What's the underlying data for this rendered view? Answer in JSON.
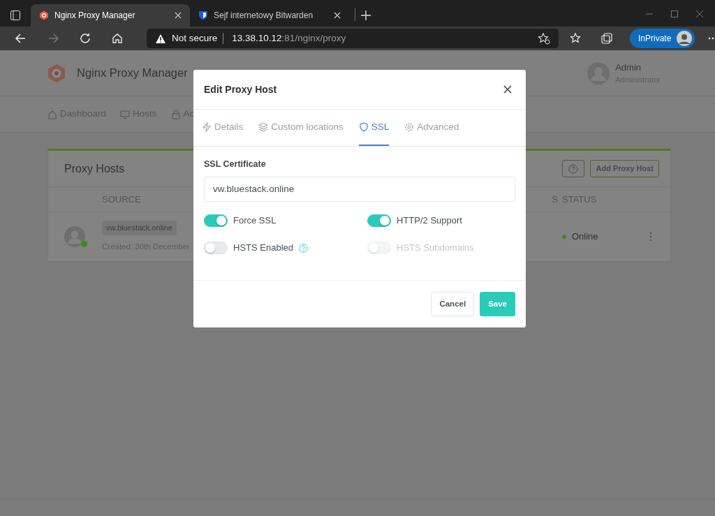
{
  "browser": {
    "tabs": [
      {
        "title": "Nginx Proxy Manager",
        "selected": true
      },
      {
        "title": "Sejf internetowy Bitwarden",
        "selected": false
      }
    ],
    "address": {
      "security": "Not secure",
      "host": "13.38.10.12",
      "path": ":81/nginx/proxy"
    },
    "profile": "InPrivate"
  },
  "app": {
    "brand": "Nginx Proxy Manager",
    "user": {
      "name": "Admin",
      "role": "Administrator"
    },
    "nav": [
      {
        "label": "Dashboard"
      },
      {
        "label": "Hosts"
      },
      {
        "label": "Ac"
      }
    ],
    "card": {
      "title": "Proxy Hosts",
      "add_button": "Add Proxy Host",
      "columns": [
        "SOURCE",
        "S",
        "STATUS"
      ],
      "rows": [
        {
          "source": "vw.bluestack.online",
          "created": "Created: 30th December",
          "status": "Online",
          "online": true
        }
      ]
    }
  },
  "modal": {
    "title": "Edit Proxy Host",
    "tabs": [
      {
        "label": "Details",
        "selected": false
      },
      {
        "label": "Custom locations",
        "selected": false
      },
      {
        "label": "SSL",
        "selected": true
      },
      {
        "label": "Advanced",
        "selected": false
      }
    ],
    "certificate_label": "SSL Certificate",
    "certificate": "vw.bluestack.online",
    "toggles": [
      {
        "label": "Force SSL",
        "on": true,
        "disabled": false,
        "help": false
      },
      {
        "label": "HTTP/2 Support",
        "on": true,
        "disabled": false,
        "help": false
      },
      {
        "label": "HSTS Enabled",
        "on": false,
        "disabled": false,
        "help": true
      },
      {
        "label": "HSTS Subdomains",
        "on": false,
        "disabled": true,
        "help": false
      }
    ],
    "buttons": [
      {
        "label": "Cancel",
        "kind": "secondary"
      },
      {
        "label": "Save",
        "kind": "primary"
      }
    ]
  }
}
